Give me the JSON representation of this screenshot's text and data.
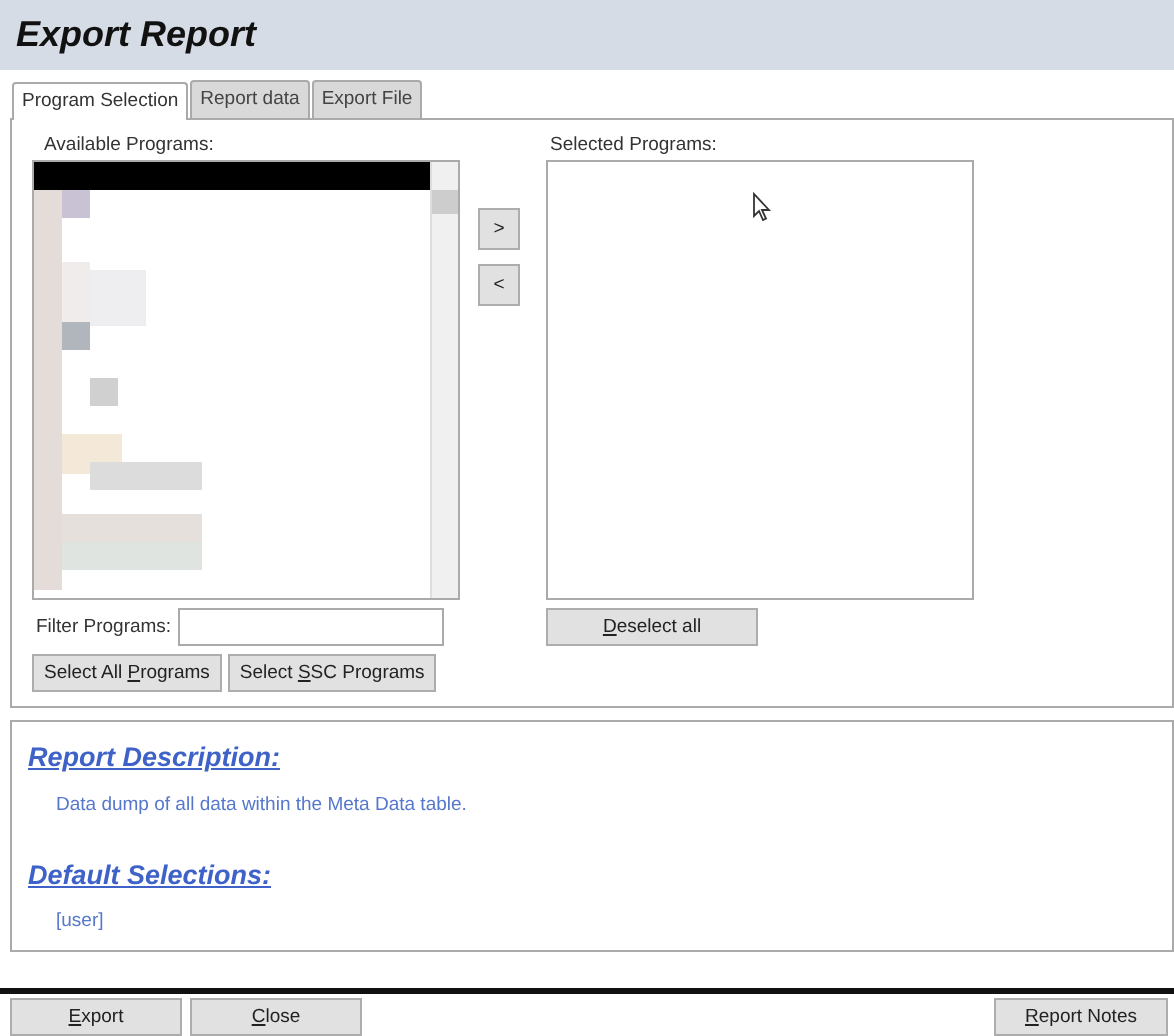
{
  "window": {
    "title": "Export Report"
  },
  "tabs": [
    {
      "label": "Program Selection",
      "selected": true
    },
    {
      "label": "Report data",
      "selected": false
    },
    {
      "label": "Export File",
      "selected": false
    }
  ],
  "available": {
    "label": "Available Programs:"
  },
  "move_buttons": [
    ">",
    "<"
  ],
  "selected_list": {
    "label": "Selected Programs:"
  },
  "deselect_button": {
    "key": "D",
    "post": "eselect all"
  },
  "filter": {
    "label": "Filter Programs:"
  },
  "select_buttons": [
    {
      "pre": "Select All ",
      "key": "P",
      "post": "rograms"
    },
    {
      "pre": "Select ",
      "key": "S",
      "post": "SC Programs"
    }
  ],
  "description": {
    "heading": "Report Description:",
    "text": "Data dump of all data within the Meta Data table."
  },
  "defaults": {
    "heading": "Default Selections:",
    "text": "[user]"
  },
  "footer_left_buttons": [
    {
      "key": "E",
      "post": "xport"
    },
    {
      "key": "C",
      "post": "lose"
    }
  ],
  "footer_right_buttons": [
    {
      "key": "R",
      "post": "eport Notes"
    }
  ]
}
